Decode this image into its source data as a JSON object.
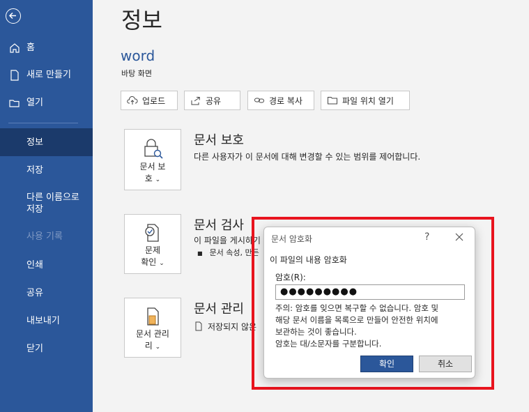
{
  "sidebar": {
    "items": [
      {
        "label": "홈",
        "icon": "home-icon"
      },
      {
        "label": "새로 만들기",
        "icon": "new-document-icon"
      },
      {
        "label": "열기",
        "icon": "folder-icon"
      },
      {
        "label": "정보"
      },
      {
        "label": "저장"
      },
      {
        "label": "다른 이름으로 저장"
      },
      {
        "label": "사용 기록"
      },
      {
        "label": "인쇄"
      },
      {
        "label": "공유"
      },
      {
        "label": "내보내기"
      },
      {
        "label": "닫기"
      }
    ]
  },
  "page": {
    "title": "정보",
    "doc_name": "word",
    "doc_location": "바탕 화면"
  },
  "toolbar": {
    "upload": "업로드",
    "share": "공유",
    "copy_path": "경로 복사",
    "open_location": "파일 위치 열기"
  },
  "sections": {
    "protect": {
      "button_line1": "문서 보",
      "button_line2": "호",
      "title": "문서 보호",
      "desc": "다른 사용자가 이 문서에 대해 변경할 수 있는 범위를 제어합니다."
    },
    "inspect": {
      "button_line1": "문제",
      "button_line2": "확인",
      "title": "문서 검사",
      "desc": "이 파일을 게시하기",
      "bullet": "문서 속성, 만든"
    },
    "manage": {
      "button_line1": "문서 관리",
      "button_line2": "리",
      "title": "문서 관리",
      "desc": "저장되지 않은"
    }
  },
  "dialog": {
    "title": "문서 암호화",
    "help": "?",
    "subtitle": "이 파일의 내용 암호화",
    "password_label": "암호(R):",
    "password_value": "●●●●●●●●●",
    "warning_line1": "주의: 암호를 잊으면 복구할 수 없습니다. 암호 및",
    "warning_line2": "해당 문서 이름을 목록으로 만들어 안전한 위치에",
    "warning_line3": "보관하는 것이 좋습니다.",
    "warning_line4": "암호는 대/소문자를 구분합니다.",
    "ok": "확인",
    "cancel": "취소"
  },
  "colors": {
    "accent": "#2b579a",
    "highlight": "#e8141e"
  }
}
